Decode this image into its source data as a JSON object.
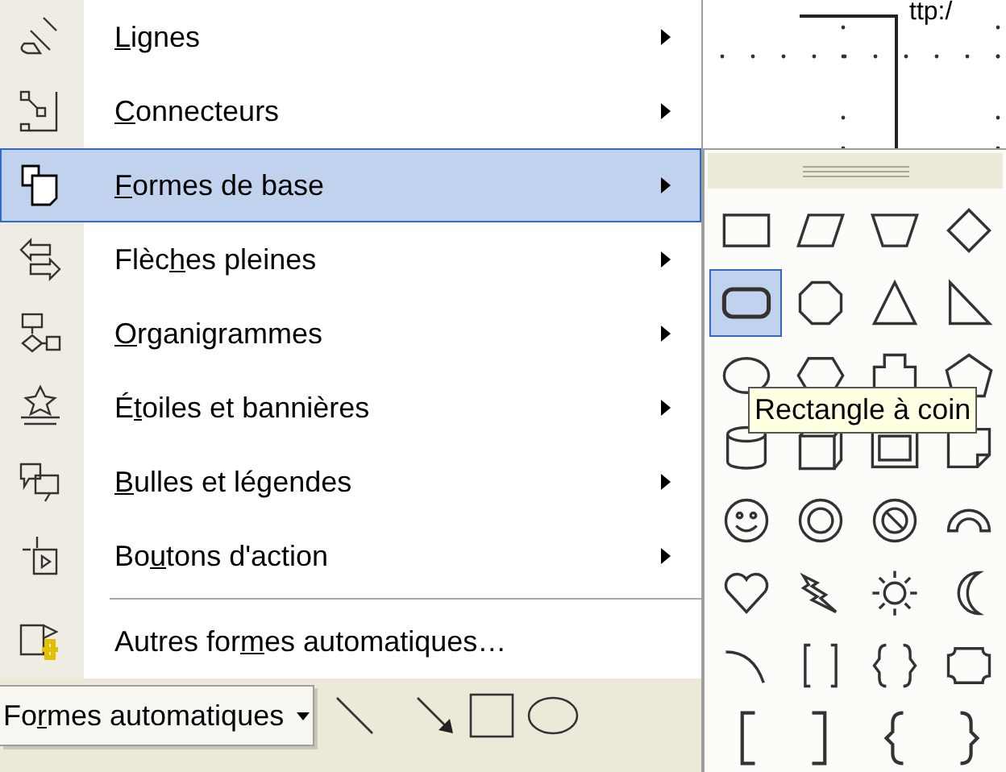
{
  "menu": {
    "items": [
      {
        "label": {
          "key": "L",
          "after": "ignes"
        },
        "has_submenu": true,
        "selected": false
      },
      {
        "label": {
          "key": "C",
          "after": "onnecteurs"
        },
        "has_submenu": true,
        "selected": false
      },
      {
        "label": {
          "key": "F",
          "after": "ormes de base"
        },
        "has_submenu": true,
        "selected": true
      },
      {
        "label": {
          "before": "Flèc",
          "key": "h",
          "after": "es pleines"
        },
        "has_submenu": true,
        "selected": false
      },
      {
        "label": {
          "key": "O",
          "after": "rganigrammes"
        },
        "has_submenu": true,
        "selected": false
      },
      {
        "label": {
          "before": "É",
          "key": "t",
          "after": "oiles et bannières"
        },
        "has_submenu": true,
        "selected": false
      },
      {
        "label": {
          "key": "B",
          "after": "ulles et légendes"
        },
        "has_submenu": true,
        "selected": false
      },
      {
        "label": {
          "before": "Bo",
          "key": "u",
          "after": "tons d'action"
        },
        "has_submenu": true,
        "selected": false
      },
      {
        "label": {
          "before": "Autres for",
          "key": "m",
          "after": "es automatiques…"
        },
        "has_submenu": false,
        "selected": false
      }
    ]
  },
  "toolbar": {
    "autoshapes_button": {
      "before": "Fo",
      "key": "r",
      "after": "mes automatiques"
    }
  },
  "canvas": {
    "text": "ttp:/"
  },
  "palette": {
    "shapes": [
      {
        "kind": "rectangle",
        "selected": false
      },
      {
        "kind": "parallelogram",
        "selected": false
      },
      {
        "kind": "trapezoid",
        "selected": false
      },
      {
        "kind": "diamond",
        "selected": false
      },
      {
        "kind": "rounded-rectangle",
        "selected": true
      },
      {
        "kind": "octagon",
        "selected": false
      },
      {
        "kind": "triangle",
        "selected": false
      },
      {
        "kind": "right-triangle",
        "selected": false
      },
      {
        "kind": "ellipse",
        "selected": false
      },
      {
        "kind": "hexagon",
        "selected": false
      },
      {
        "kind": "cross",
        "selected": false
      },
      {
        "kind": "pentagon",
        "selected": false
      },
      {
        "kind": "can",
        "selected": false
      },
      {
        "kind": "cube",
        "selected": false
      },
      {
        "kind": "bevel",
        "selected": false
      },
      {
        "kind": "folded-corner",
        "selected": false
      },
      {
        "kind": "smiley",
        "selected": false
      },
      {
        "kind": "donut",
        "selected": false
      },
      {
        "kind": "no-symbol",
        "selected": false
      },
      {
        "kind": "block-arc",
        "selected": false
      },
      {
        "kind": "heart",
        "selected": false
      },
      {
        "kind": "lightning",
        "selected": false
      },
      {
        "kind": "sun",
        "selected": false
      },
      {
        "kind": "moon",
        "selected": false
      },
      {
        "kind": "arc",
        "selected": false
      },
      {
        "kind": "double-bracket",
        "selected": false
      },
      {
        "kind": "double-brace",
        "selected": false
      },
      {
        "kind": "plaque",
        "selected": false
      },
      {
        "kind": "left-bracket",
        "selected": false
      },
      {
        "kind": "right-bracket",
        "selected": false
      },
      {
        "kind": "left-brace",
        "selected": false
      },
      {
        "kind": "right-brace",
        "selected": false
      }
    ],
    "tooltip": "Rectangle à coin"
  }
}
